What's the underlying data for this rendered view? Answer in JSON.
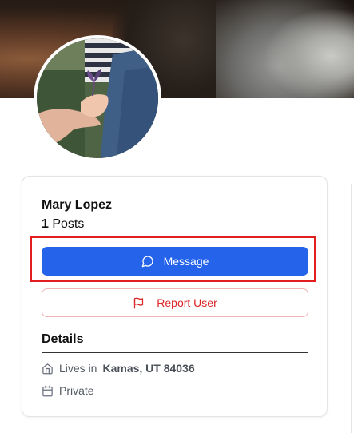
{
  "profile": {
    "name": "Mary Lopez",
    "posts_count": "1",
    "posts_label": "Posts"
  },
  "actions": {
    "message_label": "Message",
    "report_label": "Report User"
  },
  "details": {
    "title": "Details",
    "lives_prefix": "Lives in",
    "location": "Kamas, UT 84036",
    "privacy": "Private"
  },
  "icons": {
    "message": "message-circle-icon",
    "report": "flag-icon",
    "home": "home-icon",
    "calendar": "calendar-icon"
  },
  "colors": {
    "primary": "#2563eb",
    "danger": "#dc2626",
    "highlight": "#e11d1d"
  }
}
